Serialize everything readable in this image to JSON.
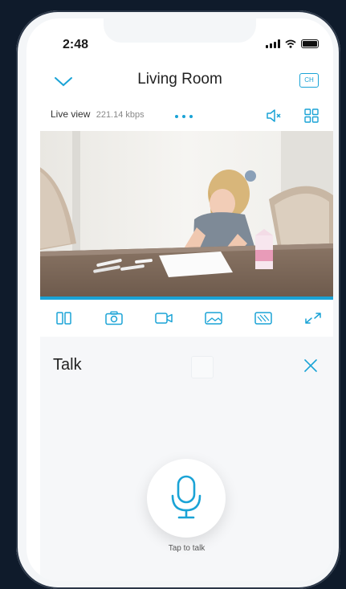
{
  "status_bar": {
    "time": "2:48"
  },
  "header": {
    "title": "Living Room",
    "channel_label": "CH"
  },
  "live": {
    "label": "Live view",
    "bitrate": "221.14 kbps",
    "progress_fraction": 1.0
  },
  "toolbar": {
    "items": [
      "split-view-icon",
      "snapshot-icon",
      "record-icon",
      "gallery-icon",
      "privacy-icon",
      "fullscreen-icon"
    ]
  },
  "talk": {
    "title": "Talk",
    "tap_label": "Tap to talk"
  },
  "colors": {
    "accent": "#1aa3d6",
    "panel": "#f6f7f9",
    "background": "#0f1b2b"
  }
}
